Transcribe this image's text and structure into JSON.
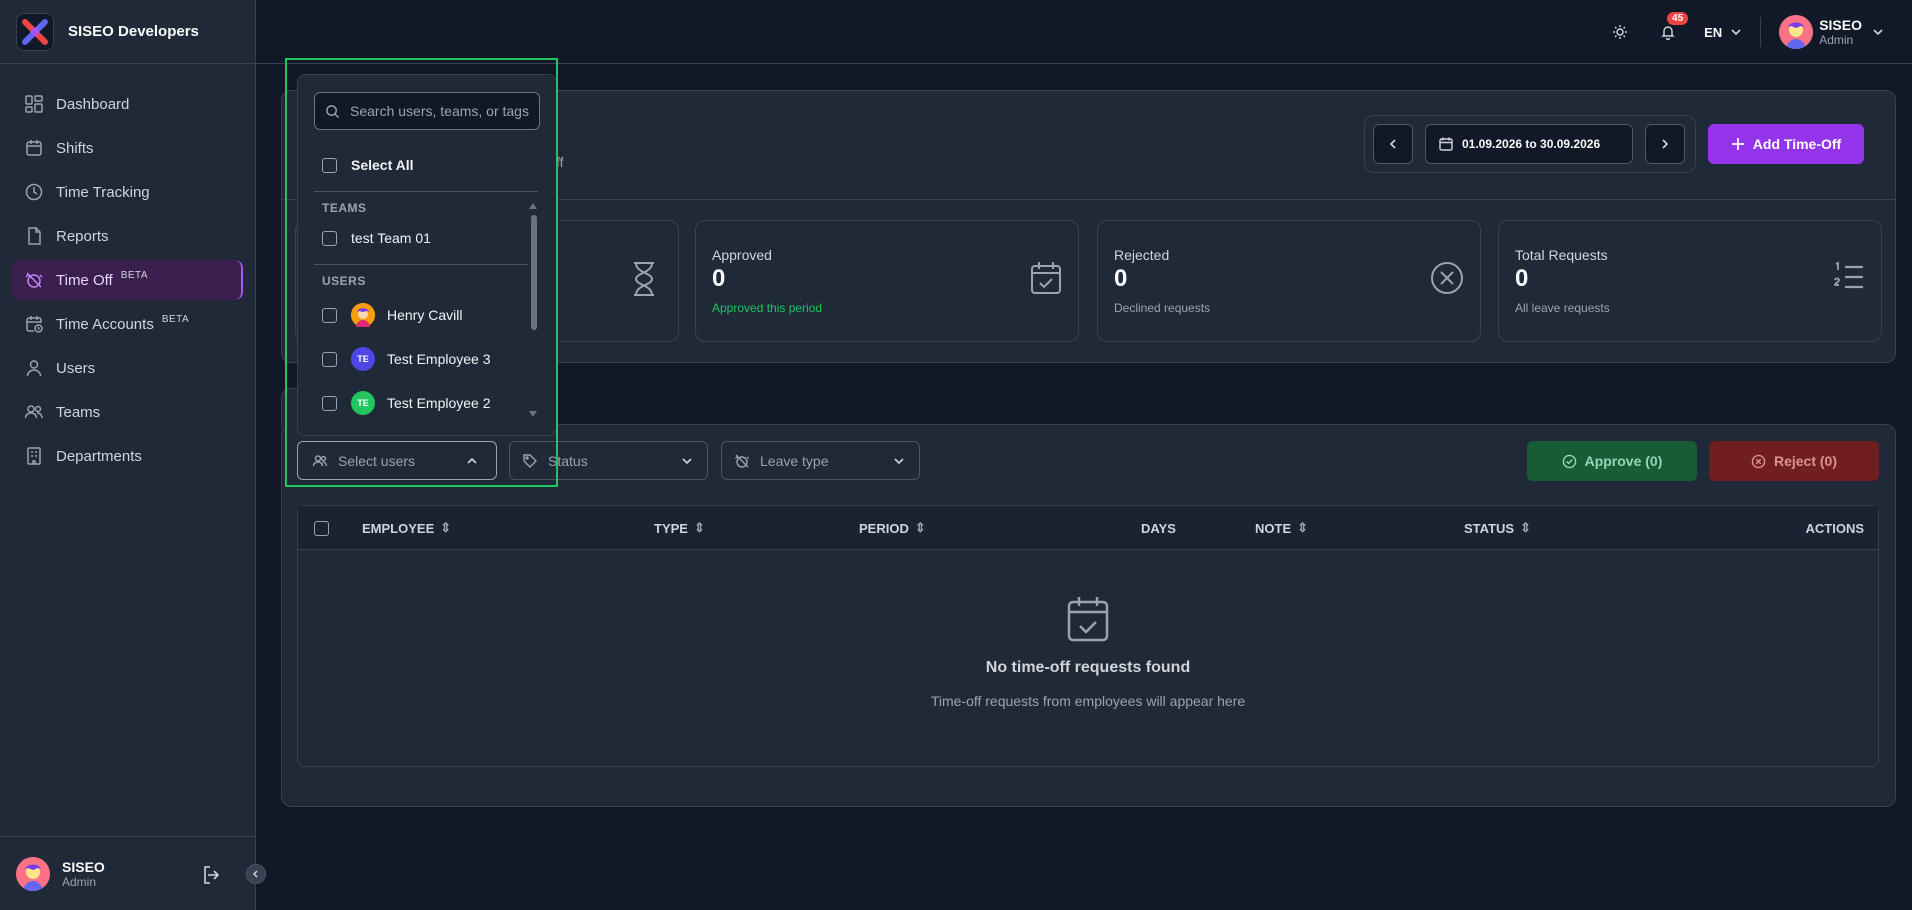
{
  "brand": {
    "name": "SISEO Developers"
  },
  "nav": [
    {
      "label": "Dashboard",
      "icon": "dashboard-icon"
    },
    {
      "label": "Shifts",
      "icon": "calendar-icon"
    },
    {
      "label": "Time Tracking",
      "icon": "clock-icon"
    },
    {
      "label": "Reports",
      "icon": "report-icon"
    },
    {
      "label": "Time Off",
      "icon": "alarm-off-icon",
      "badge": "BETA",
      "active": true
    },
    {
      "label": "Time Accounts",
      "icon": "calendar-clock-icon",
      "badge": "BETA"
    },
    {
      "label": "Users",
      "icon": "user-icon"
    },
    {
      "label": "Teams",
      "icon": "users-icon"
    },
    {
      "label": "Departments",
      "icon": "building-icon"
    }
  ],
  "sidebar_user": {
    "name": "SISEO",
    "role": "Admin"
  },
  "topbar": {
    "notifications": "45",
    "lang": "EN",
    "user_name": "SISEO",
    "user_role": "Admin"
  },
  "header": {
    "subtitle_fragment": "ff",
    "date_range": "01.09.2026 to 30.09.2026",
    "add_label": "Add Time-Off"
  },
  "stats": [
    {
      "title": "Approved",
      "value": "0",
      "sub": "Approved this period",
      "sub_color": "#22c55e"
    },
    {
      "title": "Rejected",
      "value": "0",
      "sub": "Declined requests"
    },
    {
      "title": "Total Requests",
      "value": "0",
      "sub": "All leave requests"
    }
  ],
  "filters": {
    "users": "Select users",
    "status": "Status",
    "leave_type": "Leave type"
  },
  "actions": {
    "approve": "Approve (0)",
    "reject": "Reject (0)"
  },
  "table": {
    "columns": [
      "EMPLOYEE",
      "TYPE",
      "PERIOD",
      "DAYS",
      "NOTE",
      "STATUS",
      "ACTIONS"
    ],
    "empty_title": "No time-off requests found",
    "empty_sub": "Time-off requests from employees will appear here"
  },
  "dropdown": {
    "search_placeholder": "Search users, teams, or tags",
    "select_all": "Select All",
    "teams_label": "TEAMS",
    "teams": [
      "test Team 01"
    ],
    "users_label": "USERS",
    "users": [
      {
        "name": "Henry Cavill",
        "initials": "",
        "color": "#f59e0b"
      },
      {
        "name": "Test Employee 3",
        "initials": "TE",
        "color": "#4f46e5"
      },
      {
        "name": "Test Employee 2",
        "initials": "TE",
        "color": "#22c55e"
      }
    ]
  }
}
